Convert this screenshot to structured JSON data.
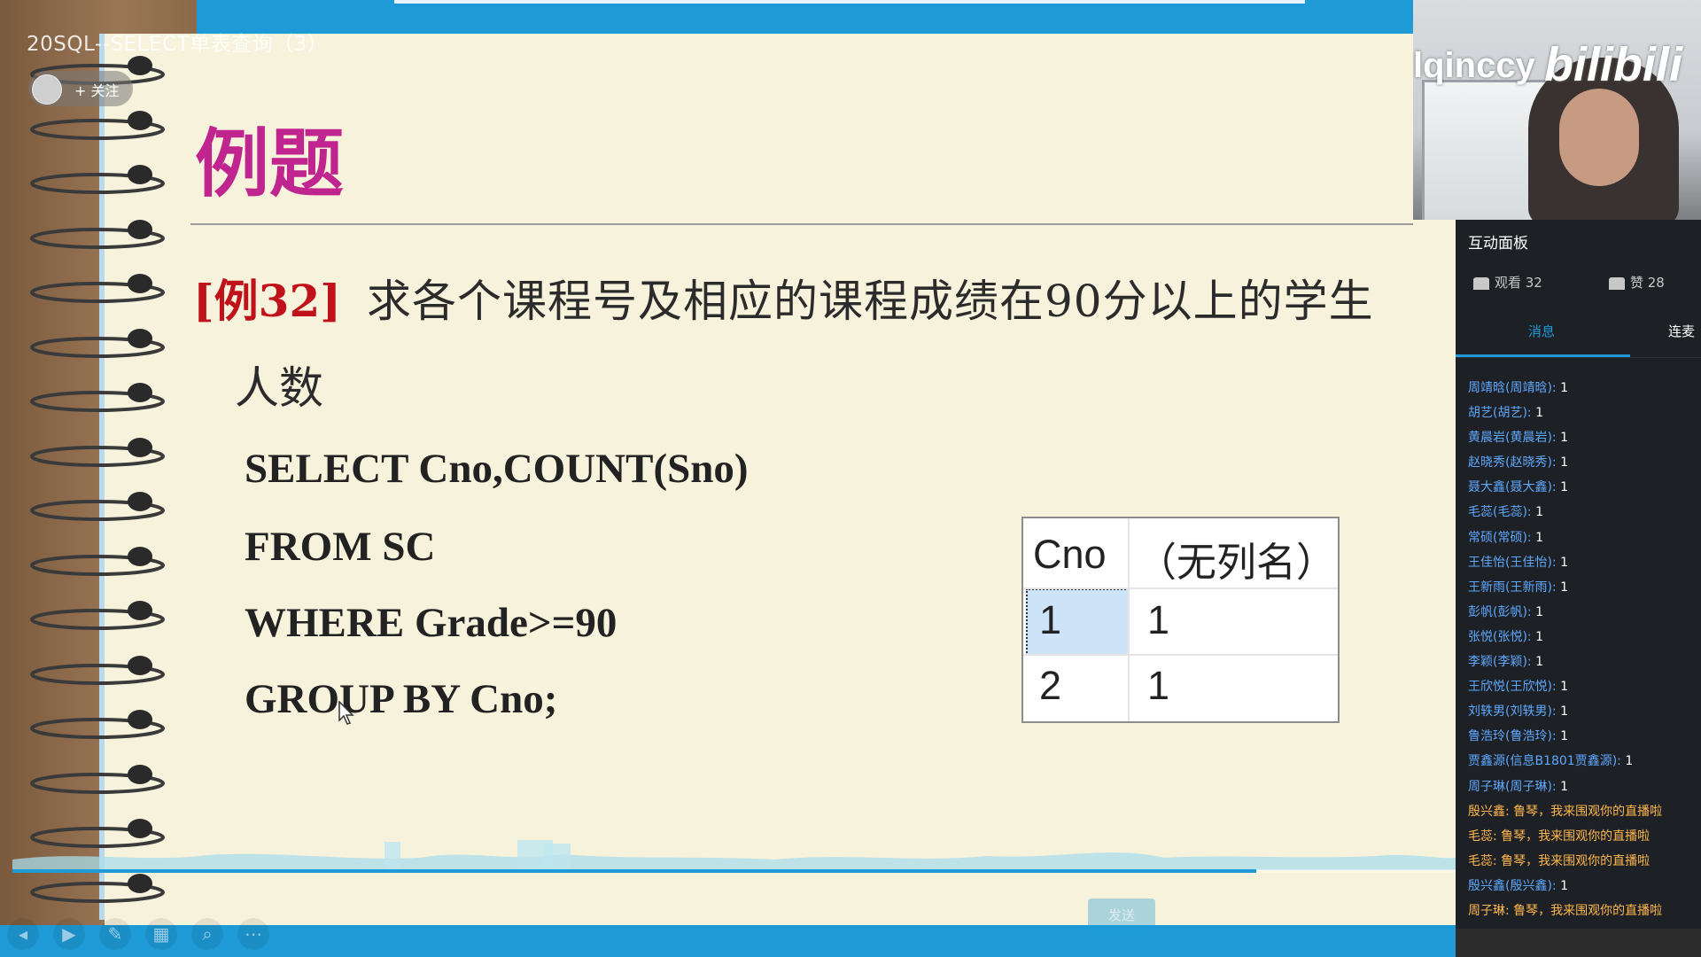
{
  "video": {
    "title": "20SQL--SELECT单表查询（3）",
    "follow_label": "+ 关注",
    "send_label": "发送"
  },
  "slide": {
    "heading": "例题",
    "example_no": "[例32]",
    "question_line1": "求各个课程号及相应的课程成绩在90分以上的学生",
    "question_line2": "人数",
    "sql": [
      "SELECT Cno,COUNT(Sno)",
      "FROM SC",
      "WHERE Grade>=90",
      "GROUP BY Cno;"
    ],
    "result_table": {
      "headers": [
        "Cno",
        "（无列名）"
      ],
      "rows": [
        [
          "1",
          "1"
        ],
        [
          "2",
          "1"
        ]
      ]
    }
  },
  "webcam": {
    "username": "lqinccy",
    "logo": "bilibili"
  },
  "panel": {
    "title": "互动面板",
    "viewers_label": "观看 32",
    "likes_label": "赞 28",
    "tab_messages": "消息",
    "tab_connect": "连麦",
    "messages": [
      {
        "name": "周靖晗(周靖晗):",
        "text": " 1"
      },
      {
        "name": "胡艺(胡艺):",
        "text": " 1"
      },
      {
        "name": "黄晨岩(黄晨岩):",
        "text": " 1"
      },
      {
        "name": "赵晓秀(赵晓秀):",
        "text": " 1"
      },
      {
        "name": "聂大鑫(聂大鑫):",
        "text": " 1"
      },
      {
        "name": "毛蕊(毛蕊):",
        "text": " 1"
      },
      {
        "name": "常硕(常硕):",
        "text": " 1"
      },
      {
        "name": "王佳怡(王佳怡):",
        "text": " 1"
      },
      {
        "name": "王新雨(王新雨):",
        "text": " 1"
      },
      {
        "name": "彭帆(彭帆):",
        "text": " 1"
      },
      {
        "name": "张悦(张悦):",
        "text": " 1"
      },
      {
        "name": "李颖(李颖):",
        "text": " 1"
      },
      {
        "name": "王欣悦(王欣悦):",
        "text": " 1"
      },
      {
        "name": "刘轶男(刘轶男):",
        "text": " 1"
      },
      {
        "name": "鲁浩玲(鲁浩玲):",
        "text": " 1"
      },
      {
        "name": "贾鑫源(信息B1801贾鑫源):",
        "text": " 1"
      },
      {
        "name": "周子琳(周子琳):",
        "text": " 1"
      },
      {
        "name": "殷兴鑫:",
        "text": " 鲁琴，我来围观你的直播啦",
        "highlight": true
      },
      {
        "name": "毛蕊:",
        "text": " 鲁琴，我来围观你的直播啦",
        "highlight": true
      },
      {
        "name": "毛蕊:",
        "text": " 鲁琴，我来围观你的直播啦",
        "highlight": true
      },
      {
        "name": "殷兴鑫(殷兴鑫):",
        "text": " 1"
      },
      {
        "name": "周子琳:",
        "text": " 鲁琴，我来围观你的直播啦",
        "highlight": true
      }
    ]
  },
  "progress": {
    "played_fraction": 0.862
  }
}
